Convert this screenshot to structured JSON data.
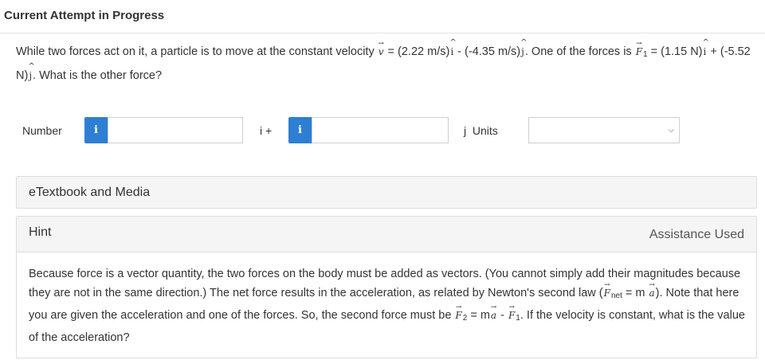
{
  "header": {
    "title": "Current Attempt in Progress"
  },
  "question": {
    "intro": "While two forces act on it, a particle is to move at the constant velocity",
    "v_symbol": "v",
    "v_eq": " = (2.22 m/s)",
    "i_hat": "i",
    "v_mid": " - (-4.35 m/s)",
    "j_hat": "j",
    "f1_lead": ". One of the forces is ",
    "f1_symbol": "F",
    "f1_sub": "1",
    "f1_eq": " = (1.15 N)",
    "f1_mid": " + (-5.52 N)",
    "ending": ". What is the other force?"
  },
  "answer": {
    "number_label": "Number",
    "info_glyph": "i",
    "i_plus": "i +",
    "j_units": "j  Units",
    "input1_value": "",
    "input2_value": "",
    "units_value": ""
  },
  "etextbook": {
    "title": "eTextbook and Media"
  },
  "hint": {
    "title": "Hint",
    "assistance": "Assistance Used",
    "text_1": "Because force is a vector quantity, the two forces on the body must be added as vectors. (You cannot simply add their magnitudes because they are not in the same direction.) The net force results in the acceleration, as related by Newton's second law (",
    "f_sym": "F",
    "net_sub": "net",
    "text_2": " = m ",
    "a_sym": "a",
    "text_3": "). Note that here you are given the acceleration and one of the forces. So, the second force must be ",
    "sub_2": "2",
    "text_4": " = m",
    "text_5": " - ",
    "sub_1": "1",
    "text_6": ". If the velocity is constant, what is the value of the acceleration?"
  }
}
